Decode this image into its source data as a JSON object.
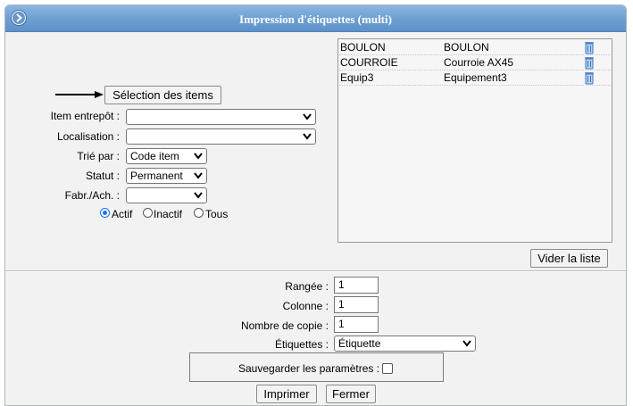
{
  "window": {
    "title": "Impression d'étiquettes (multi)"
  },
  "selection": {
    "button_label": "Sélection des items",
    "fields": [
      {
        "label": "Item entrepôt :",
        "value": ""
      },
      {
        "label": "Localisation :",
        "value": ""
      },
      {
        "label": "Trié par :",
        "value": "Code item"
      },
      {
        "label": "Statut :",
        "value": "Permanent"
      },
      {
        "label": "Fabr./Ach. :",
        "value": ""
      }
    ],
    "radios": [
      {
        "label": "Actif",
        "checked": true
      },
      {
        "label": "Inactif",
        "checked": false
      },
      {
        "label": "Tous",
        "checked": false
      }
    ]
  },
  "list": {
    "rows": [
      {
        "code": "BOULON",
        "description": "BOULON"
      },
      {
        "code": "COURROIE",
        "description": "Courroie AX45"
      },
      {
        "code": "Equip3",
        "description": "Equipement3"
      }
    ],
    "clear_label": "Vider la liste"
  },
  "print": {
    "fields": [
      {
        "label": "Rangée :",
        "value": "1"
      },
      {
        "label": "Colonne :",
        "value": "1"
      },
      {
        "label": "Nombre de copie :",
        "value": "1"
      }
    ],
    "labels_field": {
      "label": "Étiquettes :",
      "value": "Étiquette"
    },
    "save_params": {
      "label": "Sauvegarder les paramètres :",
      "checked": false
    },
    "print_label": "Imprimer",
    "close_label": "Fermer"
  },
  "colors": {
    "title_bar": "#6c9fd2",
    "background": "#f2f2f2",
    "radio_accent": "#1a73e8"
  },
  "icons": {
    "title": "circle-arrow-right-icon",
    "row_delete": "trash-icon",
    "arrow": "arrow-right-icon"
  }
}
